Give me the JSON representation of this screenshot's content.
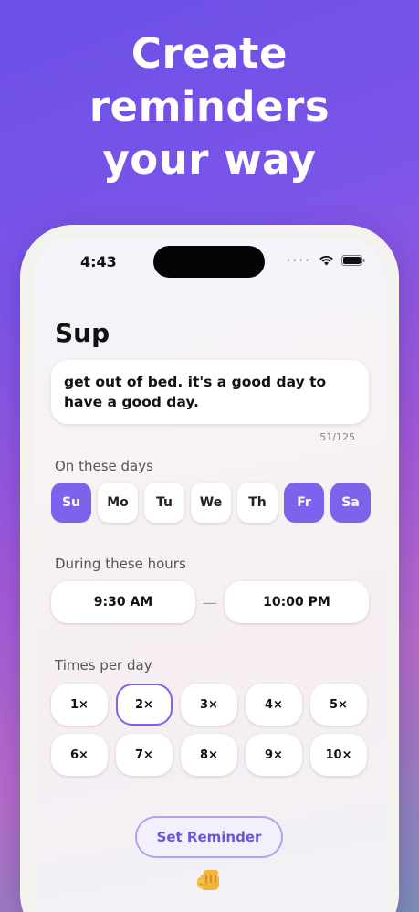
{
  "headline": [
    "Create",
    "reminders",
    "your way"
  ],
  "status_bar": {
    "time": "4:43",
    "dots": "••••"
  },
  "reminder": {
    "title": "Sup",
    "text": "get out of bed. it's a good day to have a good day.",
    "counter": "51/125"
  },
  "days": {
    "label": "On these days",
    "items": [
      {
        "label": "Su",
        "active": true
      },
      {
        "label": "Mo",
        "active": false
      },
      {
        "label": "Tu",
        "active": false
      },
      {
        "label": "We",
        "active": false
      },
      {
        "label": "Th",
        "active": false
      },
      {
        "label": "Fr",
        "active": true
      },
      {
        "label": "Sa",
        "active": true
      }
    ]
  },
  "hours": {
    "label": "During these hours",
    "start": "9:30 AM",
    "separator": "—",
    "end": "10:00 PM"
  },
  "times_per_day": {
    "label": "Times per day",
    "options": [
      "1×",
      "2×",
      "3×",
      "4×",
      "5×",
      "6×",
      "7×",
      "8×",
      "9×",
      "10×"
    ],
    "selected": "2×"
  },
  "action": {
    "set_label": "Set Reminder"
  },
  "colors": {
    "accent": "#7d62ec",
    "button_text": "#6b55d8"
  },
  "icons": {
    "emoji": "fist-icon"
  }
}
